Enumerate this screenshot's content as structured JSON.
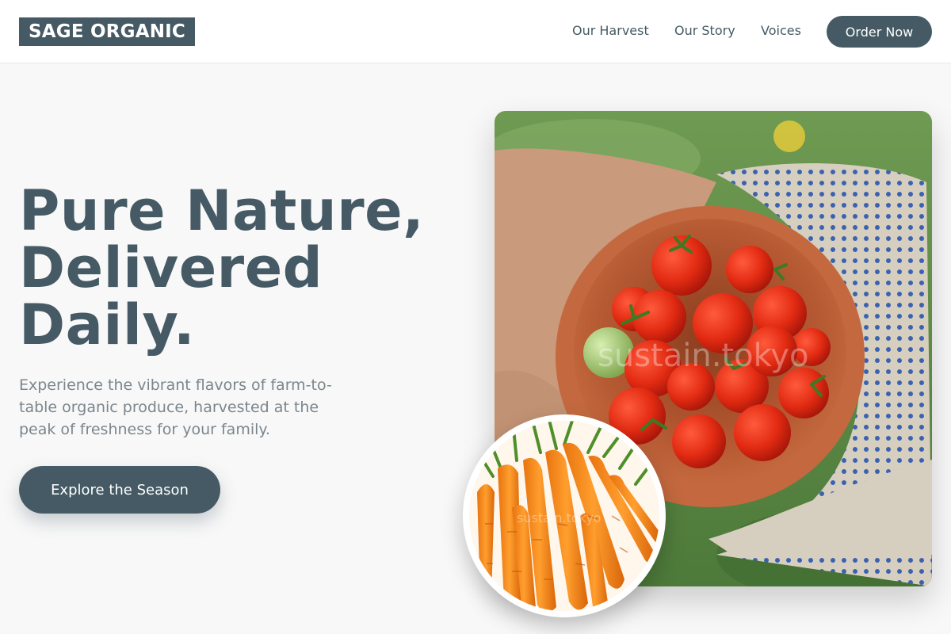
{
  "header": {
    "logo": "SAGE ORGANIC",
    "nav": [
      "Our Harvest",
      "Our Story",
      "Voices"
    ],
    "cta_label": "Order Now"
  },
  "hero": {
    "headline": [
      "Pure Nature,",
      "Delivered",
      "Daily."
    ],
    "subtext": "Experience the vibrant flavors of farm-to-table organic produce, harvested at the peak of freshness for your family.",
    "cta_label": "Explore the Season"
  },
  "images": {
    "main": {
      "subject": "hands-holding-bowl-of-tomatoes",
      "watermark": "sustain.tokyo"
    },
    "inset": {
      "subject": "bunch-of-carrots",
      "watermark": "sustain.tokyo"
    }
  },
  "colors": {
    "primary": "#455a64",
    "background": "#f8f8f8",
    "text_muted": "#7b868c"
  }
}
